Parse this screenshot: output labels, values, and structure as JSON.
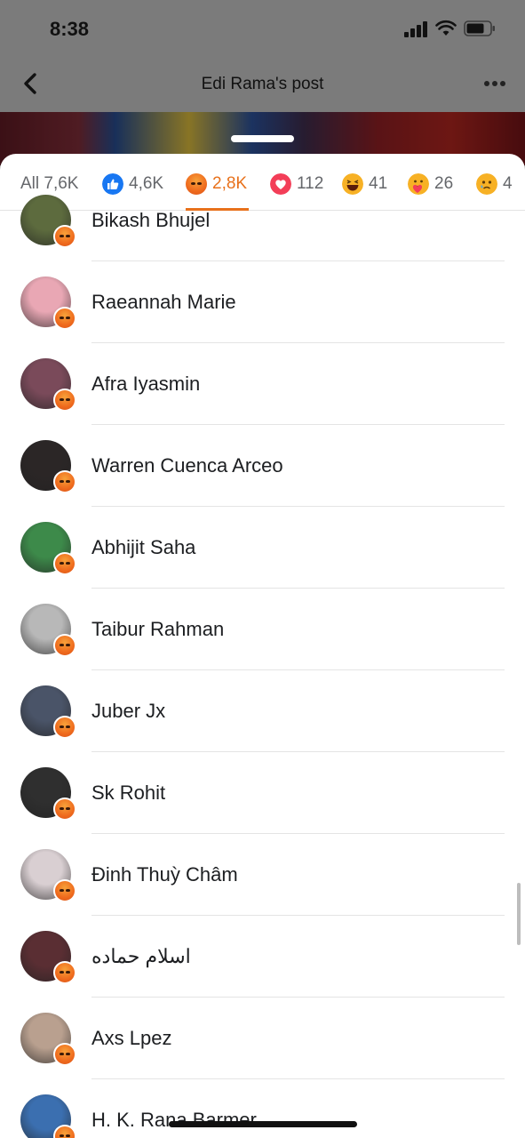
{
  "status": {
    "time": "8:38"
  },
  "nav": {
    "title": "Edi Rama's post"
  },
  "tabs": [
    {
      "label": "All 7,6K",
      "icon": "",
      "color": ""
    },
    {
      "label": "4,6K",
      "icon": "like-icon",
      "color": "#1877f2"
    },
    {
      "label": "2,8K",
      "icon": "angry-icon",
      "color": "#e8711b",
      "active": true
    },
    {
      "label": "112",
      "icon": "love-icon",
      "color": "#f33e58"
    },
    {
      "label": "41",
      "icon": "haha-icon",
      "color": "#f7b125"
    },
    {
      "label": "26",
      "icon": "care-icon",
      "color": "#f7b125"
    },
    {
      "label": "4",
      "icon": "sad-icon",
      "color": "#f7b125"
    }
  ],
  "people": [
    {
      "name": "Bikash Bhujel",
      "avatar_color": "#5d6b3e"
    },
    {
      "name": "Raeannah Marie",
      "avatar_color": "#e9a7b4"
    },
    {
      "name": "Afra Iyasmin",
      "avatar_color": "#7a4a5a"
    },
    {
      "name": "Warren Cuenca Arceo",
      "avatar_color": "#2b2626"
    },
    {
      "name": "Abhijit Saha",
      "avatar_color": "#3d8a4a"
    },
    {
      "name": "Taibur Rahman",
      "avatar_color": "#b8b8b8"
    },
    {
      "name": "Juber Jx",
      "avatar_color": "#4a5468"
    },
    {
      "name": "Sk Rohit",
      "avatar_color": "#2f2f2f"
    },
    {
      "name": "Đinh Thuỳ Châm",
      "avatar_color": "#d9cfd2"
    },
    {
      "name": "اسلام حماده",
      "avatar_color": "#5a2e33"
    },
    {
      "name": "Axs Lpez",
      "avatar_color": "#b9a08f"
    },
    {
      "name": "H. K. Rana Barmer",
      "avatar_color": "#3b6fb0"
    }
  ],
  "colors": {
    "accent": "#e8711b",
    "reaction_badge": "angry-icon"
  }
}
